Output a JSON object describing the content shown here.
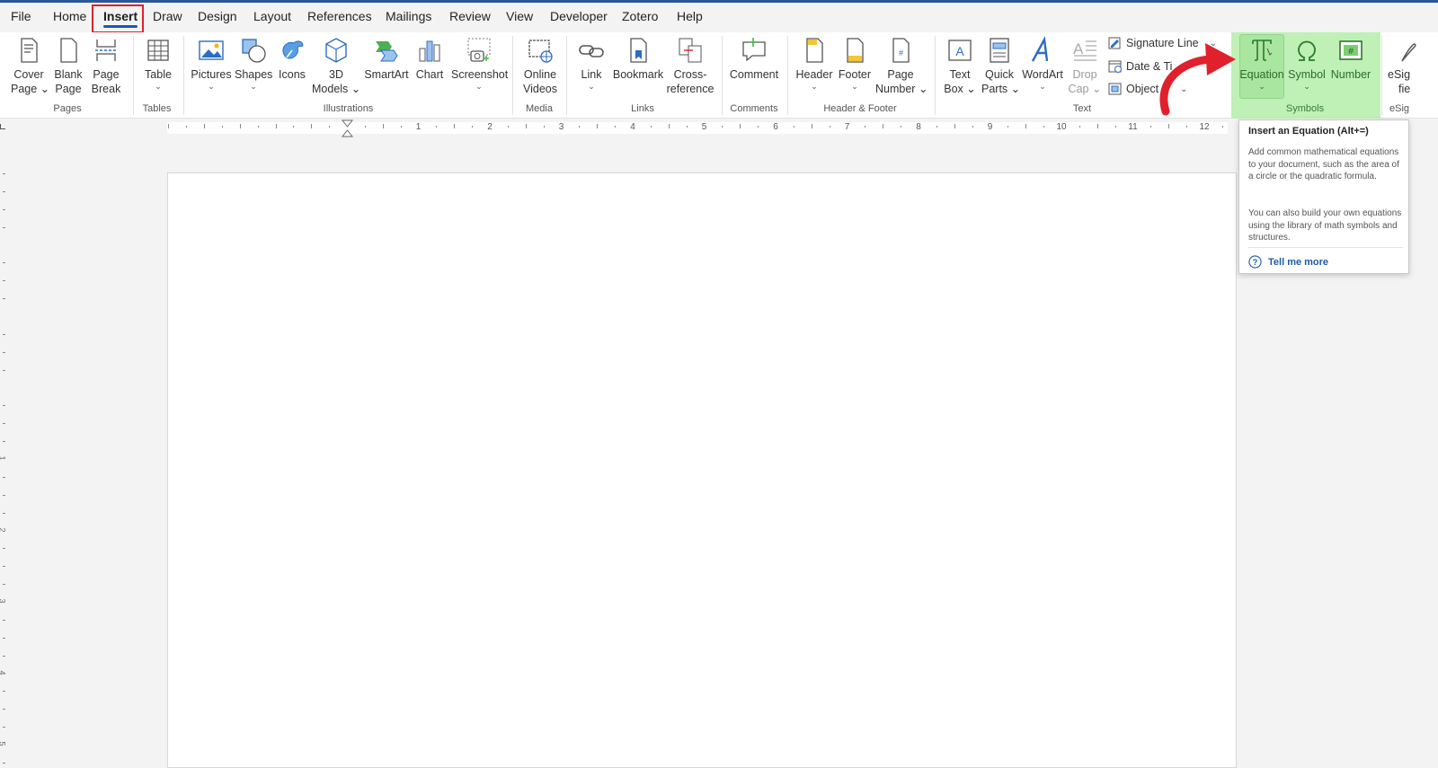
{
  "menu_tabs": [
    "File",
    "Home",
    "Insert",
    "Draw",
    "Design",
    "Layout",
    "References",
    "Mailings",
    "Review",
    "View",
    "Developer",
    "Zotero",
    "Help"
  ],
  "active_tab": "Insert",
  "ribbon": {
    "cover_page": [
      "Cover",
      "Page"
    ],
    "blank_page": [
      "Blank",
      "Page"
    ],
    "page_break": [
      "Page",
      "Break"
    ],
    "table": "Table",
    "pictures": "Pictures",
    "shapes": "Shapes",
    "icons": "Icons",
    "models3d": [
      "3D",
      "Models"
    ],
    "smartart": "SmartArt",
    "chart": "Chart",
    "screenshot": "Screenshot",
    "online_videos": [
      "Online",
      "Videos"
    ],
    "link": "Link",
    "bookmark": "Bookmark",
    "cross_reference": [
      "Cross-",
      "reference"
    ],
    "comment": "Comment",
    "header": "Header",
    "footer": "Footer",
    "page_number": [
      "Page",
      "Number"
    ],
    "text_box": [
      "Text",
      "Box"
    ],
    "quick_parts": [
      "Quick",
      "Parts"
    ],
    "wordart": "WordArt",
    "drop_cap": [
      "Drop",
      "Cap"
    ],
    "signature_line": "Signature Line",
    "date_time": "Date & Ti",
    "object": "Object",
    "equation": "Equation",
    "symbol": "Symbol",
    "number": "Number",
    "esig": [
      "eSig",
      "fie"
    ]
  },
  "groups": {
    "pages": "Pages",
    "tables": "Tables",
    "illustrations": "Illustrations",
    "media": "Media",
    "links": "Links",
    "comments": "Comments",
    "header_footer": "Header & Footer",
    "text": "Text",
    "symbols": "Symbols",
    "esig": "eSig"
  },
  "ruler_numbers": [
    "1",
    "2",
    "3",
    "4",
    "5",
    "6",
    "7",
    "8",
    "9",
    "10",
    "11",
    "12"
  ],
  "vruler_numbers": [
    "1",
    "2",
    "3",
    "4",
    "5"
  ],
  "tooltip": {
    "title": "Insert an Equation (Alt+=)",
    "para1": "Add common mathematical equations to your document, such as the area of a circle or the quadratic formula.",
    "para2": "You can also build your own equations using the library of math symbols and structures.",
    "link": "Tell me more"
  },
  "colors": {
    "accent": "#185abd",
    "highlight": "#bff0b6",
    "annotation": "#e0202c"
  }
}
